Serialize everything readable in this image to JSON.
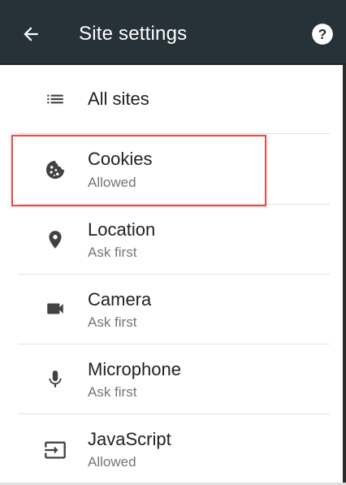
{
  "header": {
    "title": "Site settings",
    "back_icon": "arrow-back-icon",
    "help_icon": "help-circle-icon",
    "background_color": "#263238"
  },
  "items": [
    {
      "label": "All sites",
      "sublabel": "",
      "icon": "list-icon"
    },
    {
      "label": "Cookies",
      "sublabel": "Allowed",
      "icon": "cookie-icon",
      "highlighted": true
    },
    {
      "label": "Location",
      "sublabel": "Ask first",
      "icon": "location-pin-icon"
    },
    {
      "label": "Camera",
      "sublabel": "Ask first",
      "icon": "videocam-icon"
    },
    {
      "label": "Microphone",
      "sublabel": "Ask first",
      "icon": "microphone-icon"
    },
    {
      "label": "JavaScript",
      "sublabel": "Allowed",
      "icon": "javascript-icon"
    }
  ],
  "colors": {
    "highlight": "#d9534f",
    "text_primary": "#212121",
    "text_secondary": "#757575",
    "icon": "#424242"
  }
}
